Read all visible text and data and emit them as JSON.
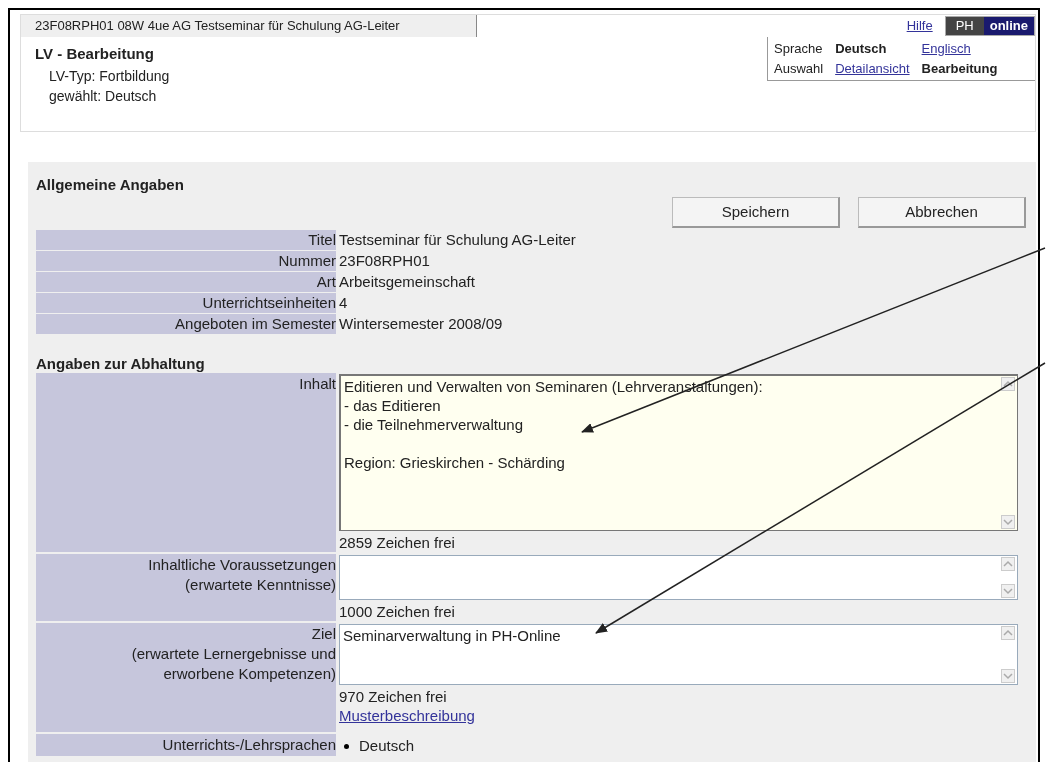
{
  "record_tab": "23F08RPH01 08W 4ue AG Testseminar für Schulung AG-Leiter",
  "help_link": "Hilfe",
  "logo": [
    "PH",
    "online"
  ],
  "header": {
    "title": "LV - Bearbeitung",
    "lines": [
      "LV-Typ: Fortbildung",
      "gewählt: Deutsch"
    ]
  },
  "selector": [
    {
      "label": "Sprache",
      "options": [
        {
          "text": "Deutsch",
          "selected": true
        },
        {
          "text": "Englisch",
          "selected": false
        }
      ]
    },
    {
      "label": "Auswahl",
      "options": [
        {
          "text": "Detailansicht",
          "selected": false
        },
        {
          "text": "Bearbeitung",
          "selected": true
        }
      ]
    }
  ],
  "general": {
    "heading": "Allgemeine Angaben",
    "buttons": [
      "Speichern",
      "Abbrechen"
    ],
    "rows": [
      {
        "label": "Titel",
        "value": "Testseminar für Schulung AG-Leiter"
      },
      {
        "label": "Nummer",
        "value": "23F08RPH01"
      },
      {
        "label": "Art",
        "value": "Arbeitsgemeinschaft"
      },
      {
        "label": "Unterrichtseinheiten",
        "value": "4"
      },
      {
        "label": "Angeboten im Semester",
        "value": "Wintersemester 2008/09"
      }
    ]
  },
  "holding": {
    "heading": "Angaben zur Abhaltung",
    "fields": [
      {
        "kind": "textarea",
        "label": [
          "Inhalt"
        ],
        "value": "Editieren und Verwalten von Seminaren (Lehrveranstaltungen):\n- das Editieren\n- die Teilnehmerverwaltung\n\nRegion: Grieskirchen - Schärding",
        "focused": true,
        "counter": "2859 Zeichen frei"
      },
      {
        "kind": "textarea",
        "label": [
          "Inhaltliche Voraussetzungen",
          "(erwartete Kenntnisse)"
        ],
        "focused": false,
        "counter": "1000 Zeichen frei"
      },
      {
        "kind": "textarea",
        "label": [
          "Ziel",
          "(erwartete Lernergebnisse und",
          "erworbene Kompetenzen)"
        ],
        "value": "Seminarverwaltung in PH-Online",
        "focused": false,
        "counter": "970 Zeichen frei",
        "link": "Musterbeschreibung"
      },
      {
        "kind": "list",
        "label": [
          "Unterrichts-/Lehrsprachen"
        ],
        "items": [
          "Deutsch"
        ]
      }
    ]
  }
}
